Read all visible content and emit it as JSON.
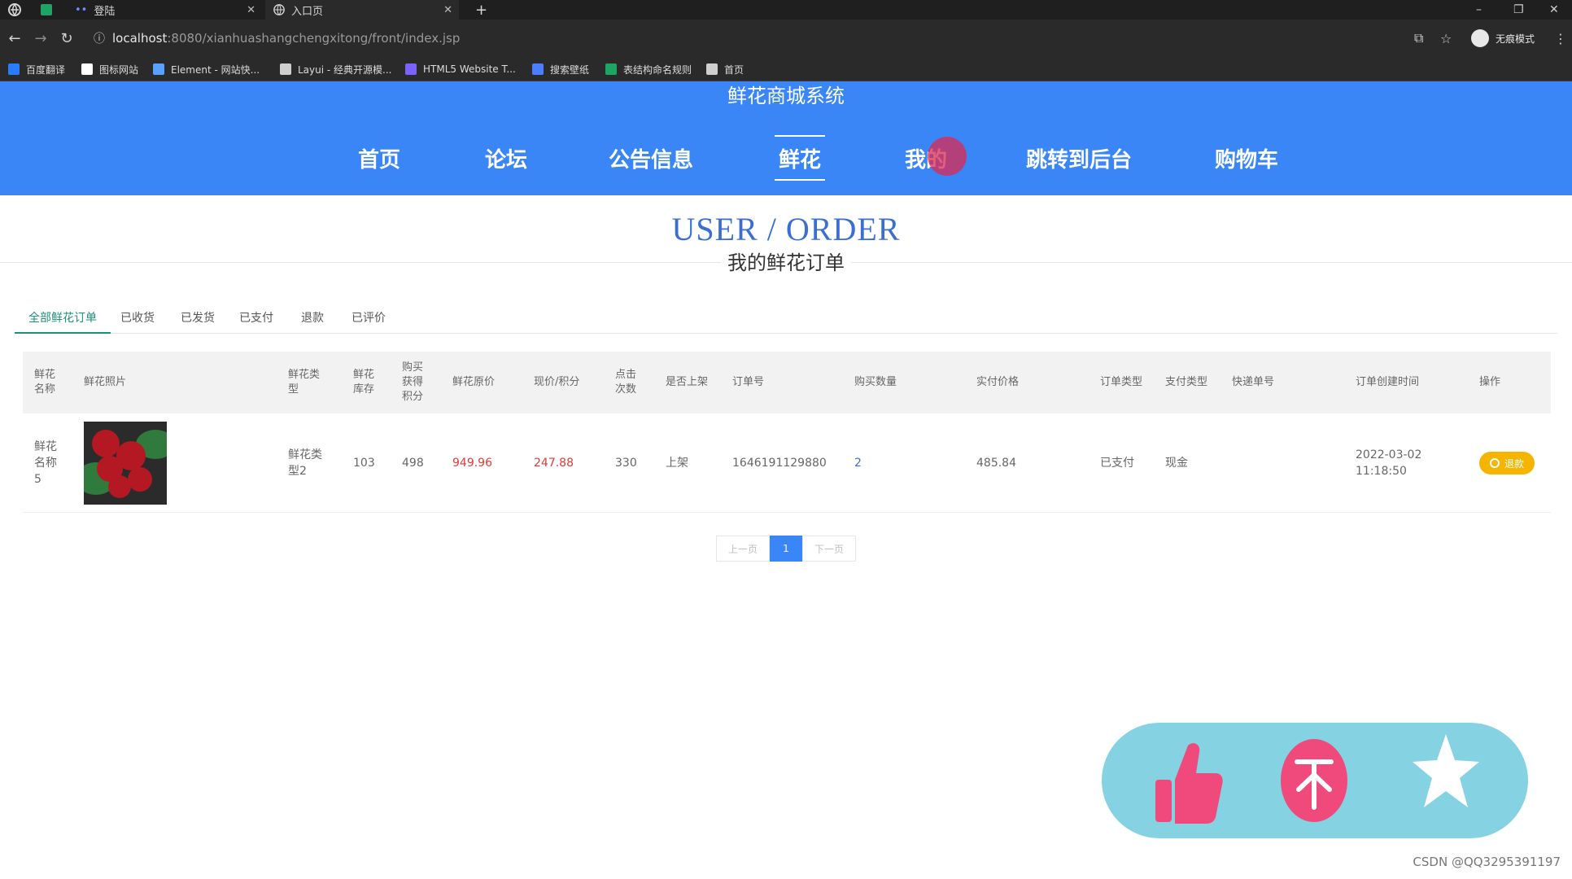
{
  "browser": {
    "tabs": [
      {
        "label": "登陆",
        "active": false
      },
      {
        "label": "入口页",
        "active": true
      }
    ],
    "new_tab": "+",
    "url_host": "localhost",
    "url_path": ":8080/xianhuashangchengxitong/front/index.jsp",
    "profile": "无痕模式",
    "bookmarks": [
      {
        "label": "百度翻译",
        "color": "#2a7cff"
      },
      {
        "label": "图标网站",
        "color": "#ffffff"
      },
      {
        "label": "Element - 网站快...",
        "color": "#5aa0ff"
      },
      {
        "label": "Layui - 经典开源模...",
        "color": "#cfcfcf"
      },
      {
        "label": "HTML5 Website T...",
        "color": "#7b61ff"
      },
      {
        "label": "搜索壁纸",
        "color": "#4a7dff"
      },
      {
        "label": "表结构命名规则",
        "color": "#1fa463"
      },
      {
        "label": "首页",
        "color": "#cfcfcf"
      }
    ]
  },
  "site": {
    "title": "鲜花商城系统",
    "accent": "#3a86f6",
    "nav": [
      {
        "label": "首页",
        "active": false
      },
      {
        "label": "论坛",
        "active": false
      },
      {
        "label": "公告信息",
        "active": false
      },
      {
        "label": "鲜花",
        "active": true
      },
      {
        "label": "我的",
        "active": false
      },
      {
        "label": "跳转到后台",
        "active": false
      },
      {
        "label": "购物车",
        "active": false
      }
    ]
  },
  "page": {
    "title": "USER / ORDER",
    "subtitle": "我的鲜花订单"
  },
  "order_tabs": [
    {
      "label": "全部鲜花订单",
      "active": true
    },
    {
      "label": "已收货",
      "active": false
    },
    {
      "label": "已发货",
      "active": false
    },
    {
      "label": "已支付",
      "active": false
    },
    {
      "label": "退款",
      "active": false
    },
    {
      "label": "已评价",
      "active": false
    }
  ],
  "table": {
    "headers": [
      "鲜花名称",
      "鲜花照片",
      "鲜花类型",
      "鲜花库存",
      "购买获得积分",
      "鲜花原价",
      "现价/积分",
      "点击次数",
      "是否上架",
      "订单号",
      "购买数量",
      "实付价格",
      "订单类型",
      "支付类型",
      "快递单号",
      "订单创建时间",
      "操作"
    ],
    "rows": [
      {
        "name": "鲜花名称5",
        "type": "鲜花类型2",
        "stock": "103",
        "points": "498",
        "original_price": "949.96",
        "current_price": "247.88",
        "clicks": "330",
        "on_shelf": "上架",
        "order_no": "1646191129880",
        "quantity": "2",
        "paid": "485.84",
        "order_type": "已支付",
        "pay_type": "现金",
        "express_no": "",
        "created": "2022-03-02 11:18:50",
        "action": "退款"
      }
    ]
  },
  "pagination": {
    "prev": "上一页",
    "current": "1",
    "next": "下一页"
  },
  "widget": {
    "icons": [
      "thumbs-up",
      "top",
      "star"
    ],
    "background": "#84d2e2",
    "like_color": "#f04a7c"
  },
  "watermark": "CSDN @QQ3295391197"
}
